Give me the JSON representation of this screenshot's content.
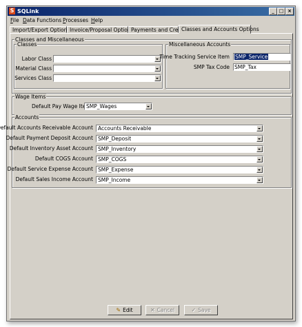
{
  "window": {
    "title": "SQLink"
  },
  "menu": [
    "File",
    "Data Functions",
    "Processes",
    "Help"
  ],
  "tabs": [
    "Import/Export Options",
    "Invoice/Proposal Options",
    "Payments and Credits",
    "Classes and Accounts Options"
  ],
  "classes_misc": {
    "legend": "Classes and Miscellaneous",
    "classes": {
      "legend": "Classes",
      "labor_label": "Labor Class",
      "labor_value": "",
      "material_label": "Material Class",
      "material_value": "",
      "services_label": "Services Class",
      "services_value": ""
    },
    "misc": {
      "legend": "Miscellaneous Accounts",
      "time_item_label": "Time Tracking Service Item",
      "time_item_value": "SMP_Service",
      "tax_code_label": "SMP Tax Code",
      "tax_code_value": "SMP_Tax"
    }
  },
  "wage_items": {
    "legend": "Wage Items",
    "pay_item_label": "Default Pay Wage Item",
    "pay_item_value": "SMP_Wages"
  },
  "accounts": {
    "legend": "Accounts",
    "rows": [
      {
        "label": "Default Accounts Receivable Account",
        "value": "Accounts Receivable"
      },
      {
        "label": "Default Payment Deposit Account",
        "value": "SMP_Deposit"
      },
      {
        "label": "Default Inventory Asset Account",
        "value": "SMP_Inventory"
      },
      {
        "label": "Default COGS Account",
        "value": "SMP_COGS"
      },
      {
        "label": "Default Service Expense Account",
        "value": "SMP_Expense"
      },
      {
        "label": "Default Sales Income Account",
        "value": "SMP_Income"
      }
    ]
  },
  "buttons": {
    "edit": "Edit",
    "cancel": "Cancel",
    "save": "Save"
  },
  "icons": {
    "app": "sqlink-icon",
    "edit": "pencil-icon",
    "cancel": "x-icon",
    "save": "checkmark-icon"
  },
  "colors": {
    "titlebar": "#0a246a",
    "selection": "#0a246a",
    "face": "#d4d0c8"
  }
}
